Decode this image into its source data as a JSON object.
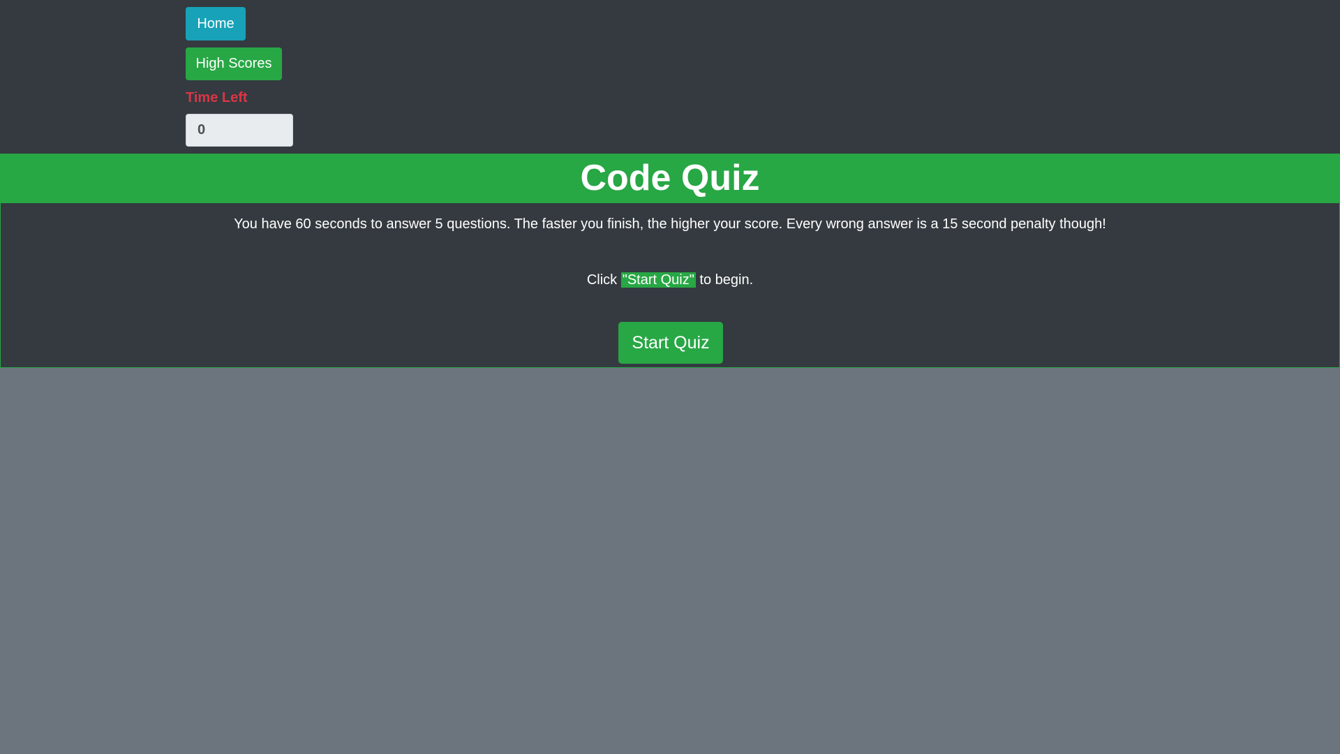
{
  "nav": {
    "home_label": "Home",
    "high_scores_label": "High Scores"
  },
  "timer": {
    "label": "Time Left",
    "value": "0"
  },
  "header": {
    "title": "Code Quiz"
  },
  "intro": {
    "description": "You have 60 seconds to answer 5 questions. The faster you finish, the higher your score. Every wrong answer is a 15 second penalty though!",
    "click_prefix": "Click ",
    "click_highlight": "\"Start Quiz\"",
    "click_suffix": " to begin.",
    "start_button_label": "Start Quiz"
  },
  "colors": {
    "page_background": "#6c757d",
    "panel_background": "#343a40",
    "success_green": "#28a745",
    "info_teal": "#17a2b8",
    "danger_red": "#dc3545"
  }
}
